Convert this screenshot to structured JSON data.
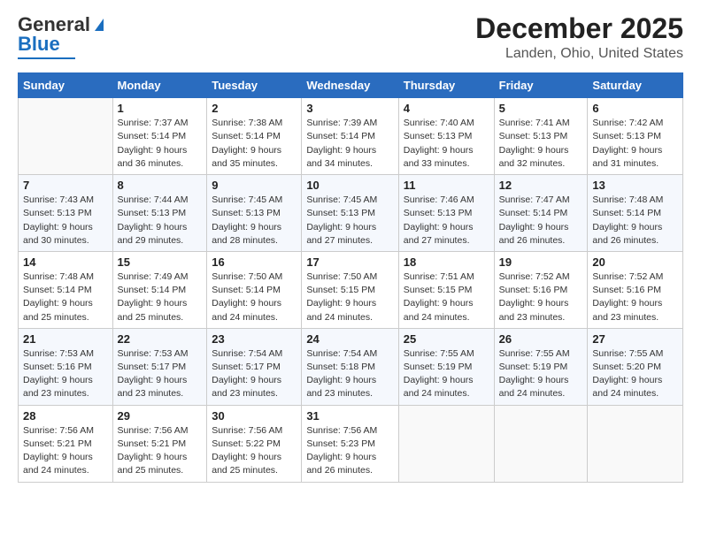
{
  "header": {
    "logo_general": "General",
    "logo_blue": "Blue",
    "title": "December 2025",
    "subtitle": "Landen, Ohio, United States"
  },
  "days_of_week": [
    "Sunday",
    "Monday",
    "Tuesday",
    "Wednesday",
    "Thursday",
    "Friday",
    "Saturday"
  ],
  "weeks": [
    [
      {
        "day": "",
        "info": ""
      },
      {
        "day": "1",
        "info": "Sunrise: 7:37 AM\nSunset: 5:14 PM\nDaylight: 9 hours\nand 36 minutes."
      },
      {
        "day": "2",
        "info": "Sunrise: 7:38 AM\nSunset: 5:14 PM\nDaylight: 9 hours\nand 35 minutes."
      },
      {
        "day": "3",
        "info": "Sunrise: 7:39 AM\nSunset: 5:14 PM\nDaylight: 9 hours\nand 34 minutes."
      },
      {
        "day": "4",
        "info": "Sunrise: 7:40 AM\nSunset: 5:13 PM\nDaylight: 9 hours\nand 33 minutes."
      },
      {
        "day": "5",
        "info": "Sunrise: 7:41 AM\nSunset: 5:13 PM\nDaylight: 9 hours\nand 32 minutes."
      },
      {
        "day": "6",
        "info": "Sunrise: 7:42 AM\nSunset: 5:13 PM\nDaylight: 9 hours\nand 31 minutes."
      }
    ],
    [
      {
        "day": "7",
        "info": "Sunrise: 7:43 AM\nSunset: 5:13 PM\nDaylight: 9 hours\nand 30 minutes."
      },
      {
        "day": "8",
        "info": "Sunrise: 7:44 AM\nSunset: 5:13 PM\nDaylight: 9 hours\nand 29 minutes."
      },
      {
        "day": "9",
        "info": "Sunrise: 7:45 AM\nSunset: 5:13 PM\nDaylight: 9 hours\nand 28 minutes."
      },
      {
        "day": "10",
        "info": "Sunrise: 7:45 AM\nSunset: 5:13 PM\nDaylight: 9 hours\nand 27 minutes."
      },
      {
        "day": "11",
        "info": "Sunrise: 7:46 AM\nSunset: 5:13 PM\nDaylight: 9 hours\nand 27 minutes."
      },
      {
        "day": "12",
        "info": "Sunrise: 7:47 AM\nSunset: 5:14 PM\nDaylight: 9 hours\nand 26 minutes."
      },
      {
        "day": "13",
        "info": "Sunrise: 7:48 AM\nSunset: 5:14 PM\nDaylight: 9 hours\nand 26 minutes."
      }
    ],
    [
      {
        "day": "14",
        "info": "Sunrise: 7:48 AM\nSunset: 5:14 PM\nDaylight: 9 hours\nand 25 minutes."
      },
      {
        "day": "15",
        "info": "Sunrise: 7:49 AM\nSunset: 5:14 PM\nDaylight: 9 hours\nand 25 minutes."
      },
      {
        "day": "16",
        "info": "Sunrise: 7:50 AM\nSunset: 5:14 PM\nDaylight: 9 hours\nand 24 minutes."
      },
      {
        "day": "17",
        "info": "Sunrise: 7:50 AM\nSunset: 5:15 PM\nDaylight: 9 hours\nand 24 minutes."
      },
      {
        "day": "18",
        "info": "Sunrise: 7:51 AM\nSunset: 5:15 PM\nDaylight: 9 hours\nand 24 minutes."
      },
      {
        "day": "19",
        "info": "Sunrise: 7:52 AM\nSunset: 5:16 PM\nDaylight: 9 hours\nand 23 minutes."
      },
      {
        "day": "20",
        "info": "Sunrise: 7:52 AM\nSunset: 5:16 PM\nDaylight: 9 hours\nand 23 minutes."
      }
    ],
    [
      {
        "day": "21",
        "info": "Sunrise: 7:53 AM\nSunset: 5:16 PM\nDaylight: 9 hours\nand 23 minutes."
      },
      {
        "day": "22",
        "info": "Sunrise: 7:53 AM\nSunset: 5:17 PM\nDaylight: 9 hours\nand 23 minutes."
      },
      {
        "day": "23",
        "info": "Sunrise: 7:54 AM\nSunset: 5:17 PM\nDaylight: 9 hours\nand 23 minutes."
      },
      {
        "day": "24",
        "info": "Sunrise: 7:54 AM\nSunset: 5:18 PM\nDaylight: 9 hours\nand 23 minutes."
      },
      {
        "day": "25",
        "info": "Sunrise: 7:55 AM\nSunset: 5:19 PM\nDaylight: 9 hours\nand 24 minutes."
      },
      {
        "day": "26",
        "info": "Sunrise: 7:55 AM\nSunset: 5:19 PM\nDaylight: 9 hours\nand 24 minutes."
      },
      {
        "day": "27",
        "info": "Sunrise: 7:55 AM\nSunset: 5:20 PM\nDaylight: 9 hours\nand 24 minutes."
      }
    ],
    [
      {
        "day": "28",
        "info": "Sunrise: 7:56 AM\nSunset: 5:21 PM\nDaylight: 9 hours\nand 24 minutes."
      },
      {
        "day": "29",
        "info": "Sunrise: 7:56 AM\nSunset: 5:21 PM\nDaylight: 9 hours\nand 25 minutes."
      },
      {
        "day": "30",
        "info": "Sunrise: 7:56 AM\nSunset: 5:22 PM\nDaylight: 9 hours\nand 25 minutes."
      },
      {
        "day": "31",
        "info": "Sunrise: 7:56 AM\nSunset: 5:23 PM\nDaylight: 9 hours\nand 26 minutes."
      },
      {
        "day": "",
        "info": ""
      },
      {
        "day": "",
        "info": ""
      },
      {
        "day": "",
        "info": ""
      }
    ]
  ]
}
